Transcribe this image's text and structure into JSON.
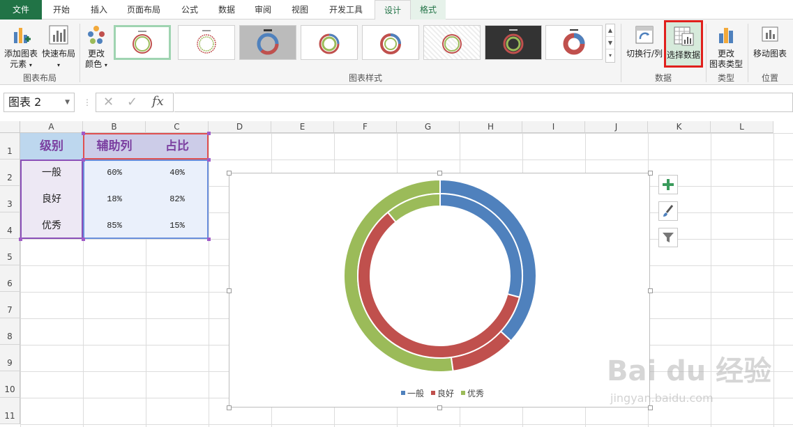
{
  "tabs": [
    {
      "label": "文件",
      "kind": "file"
    },
    {
      "label": "开始",
      "kind": "normal"
    },
    {
      "label": "插入",
      "kind": "normal"
    },
    {
      "label": "页面布局",
      "kind": "normal"
    },
    {
      "label": "公式",
      "kind": "normal"
    },
    {
      "label": "数据",
      "kind": "normal"
    },
    {
      "label": "审阅",
      "kind": "normal"
    },
    {
      "label": "视图",
      "kind": "normal"
    },
    {
      "label": "开发工具",
      "kind": "normal"
    },
    {
      "label": "设计",
      "kind": "active"
    },
    {
      "label": "格式",
      "kind": "ctx"
    }
  ],
  "ribbon": {
    "chart_layout": {
      "add_element_line1": "添加图表",
      "add_element_line2": "元素",
      "quick_layout": "快速布局",
      "group_label": "图表布局"
    },
    "change_colors_line1": "更改",
    "change_colors_line2": "颜色",
    "styles_group_label": "图表样式",
    "data": {
      "switch_row_col": "切换行/列",
      "select_data": "选择数据",
      "group_label": "数据"
    },
    "type": {
      "change_type_line1": "更改",
      "change_type_line2": "图表类型",
      "group_label": "类型"
    },
    "location": {
      "move_chart": "移动图表",
      "group_label": "位置"
    }
  },
  "formula_bar": {
    "name_box": "图表 2",
    "cancel_glyph": "✕",
    "enter_glyph": "✓",
    "fx": "fx",
    "value": ""
  },
  "sheet": {
    "columns": [
      "A",
      "B",
      "C",
      "D",
      "E",
      "F",
      "G",
      "H",
      "I",
      "J",
      "K",
      "L"
    ],
    "rows": [
      "1",
      "2",
      "3",
      "4",
      "5",
      "6",
      "7",
      "8",
      "9",
      "10",
      "11"
    ],
    "headers": [
      "级别",
      "辅助列",
      "占比"
    ],
    "data": [
      [
        "一般",
        "60%",
        "40%"
      ],
      [
        "良好",
        "18%",
        "82%"
      ],
      [
        "优秀",
        "85%",
        "15%"
      ]
    ]
  },
  "chart_data": {
    "type": "doughnut",
    "categories": [
      "辅助列",
      "占比"
    ],
    "series": [
      {
        "name": "一般",
        "values": [
          60,
          40
        ],
        "color": "#4f81bd"
      },
      {
        "name": "良好",
        "values": [
          18,
          82
        ],
        "color": "#c0504d"
      },
      {
        "name": "优秀",
        "values": [
          85,
          15
        ],
        "color": "#9bbb59"
      }
    ],
    "legend": "bottom",
    "legend_labels": [
      "一般",
      "良好",
      "优秀"
    ]
  },
  "watermark": {
    "brand": "Bai du 经验",
    "url": "jingyan.baidu.com"
  }
}
